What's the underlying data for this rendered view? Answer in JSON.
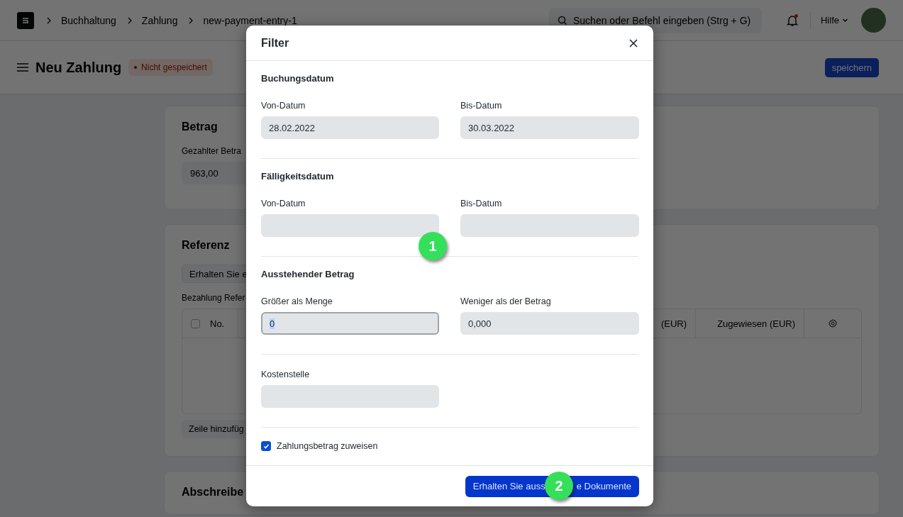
{
  "topbar": {
    "breadcrumbs": [
      "Buchhaltung",
      "Zahlung",
      "new-payment-entry-1"
    ],
    "search": {
      "placeholder": "Suchen oder Befehl eingeben (Strg + G)"
    },
    "notifications": {
      "unread": true
    },
    "help": "Hilfe"
  },
  "page": {
    "title": "Neu Zahlung",
    "status": "Nicht gespeichert",
    "save": "speichern"
  },
  "amount_card": {
    "title": "Betrag",
    "label": "Gezahlter Betra",
    "value": "963,00"
  },
  "reference_card": {
    "title": "Referenz",
    "fetch_button": "Erhalten Sie e",
    "table_label": "Bezahlung Refer",
    "select_all": {
      "checked": false
    },
    "columns": [
      "No.",
      "(EUR)",
      "Zugewiesen (EUR)"
    ],
    "add_row": "Zeile hinzufüg"
  },
  "writeoff_card": {
    "title": "Abschreibe"
  },
  "dialog": {
    "title": "Filter",
    "sections": [
      {
        "heading": "Buchungsdatum",
        "fields": [
          {
            "label": "Von-Datum",
            "value": "28.02.2022",
            "focused": false
          },
          {
            "label": "Bis-Datum",
            "value": "30.03.2022",
            "focused": false
          }
        ]
      },
      {
        "heading": "Fälligkeitsdatum",
        "fields": [
          {
            "label": "Von-Datum",
            "focused": false
          },
          {
            "label": "Bis-Datum",
            "focused": false
          }
        ]
      },
      {
        "heading": "Ausstehender Betrag",
        "fields": [
          {
            "label": "Größer als Menge",
            "value": "0",
            "focused": true
          },
          {
            "label": "Weniger als der Betrag",
            "value": "0,000",
            "focused": false
          }
        ]
      },
      {
        "fields": [
          {
            "label": "Kostenstelle",
            "focused": false
          }
        ]
      },
      {
        "checkboxes": [
          {
            "label": "Zahlungsbetrag zuweisen",
            "checked": true
          }
        ]
      }
    ],
    "primary_button": {
      "label_start": "Erhalten Sie auss",
      "label_end": "e Dokumente"
    }
  },
  "markers": [
    "1",
    "2"
  ]
}
